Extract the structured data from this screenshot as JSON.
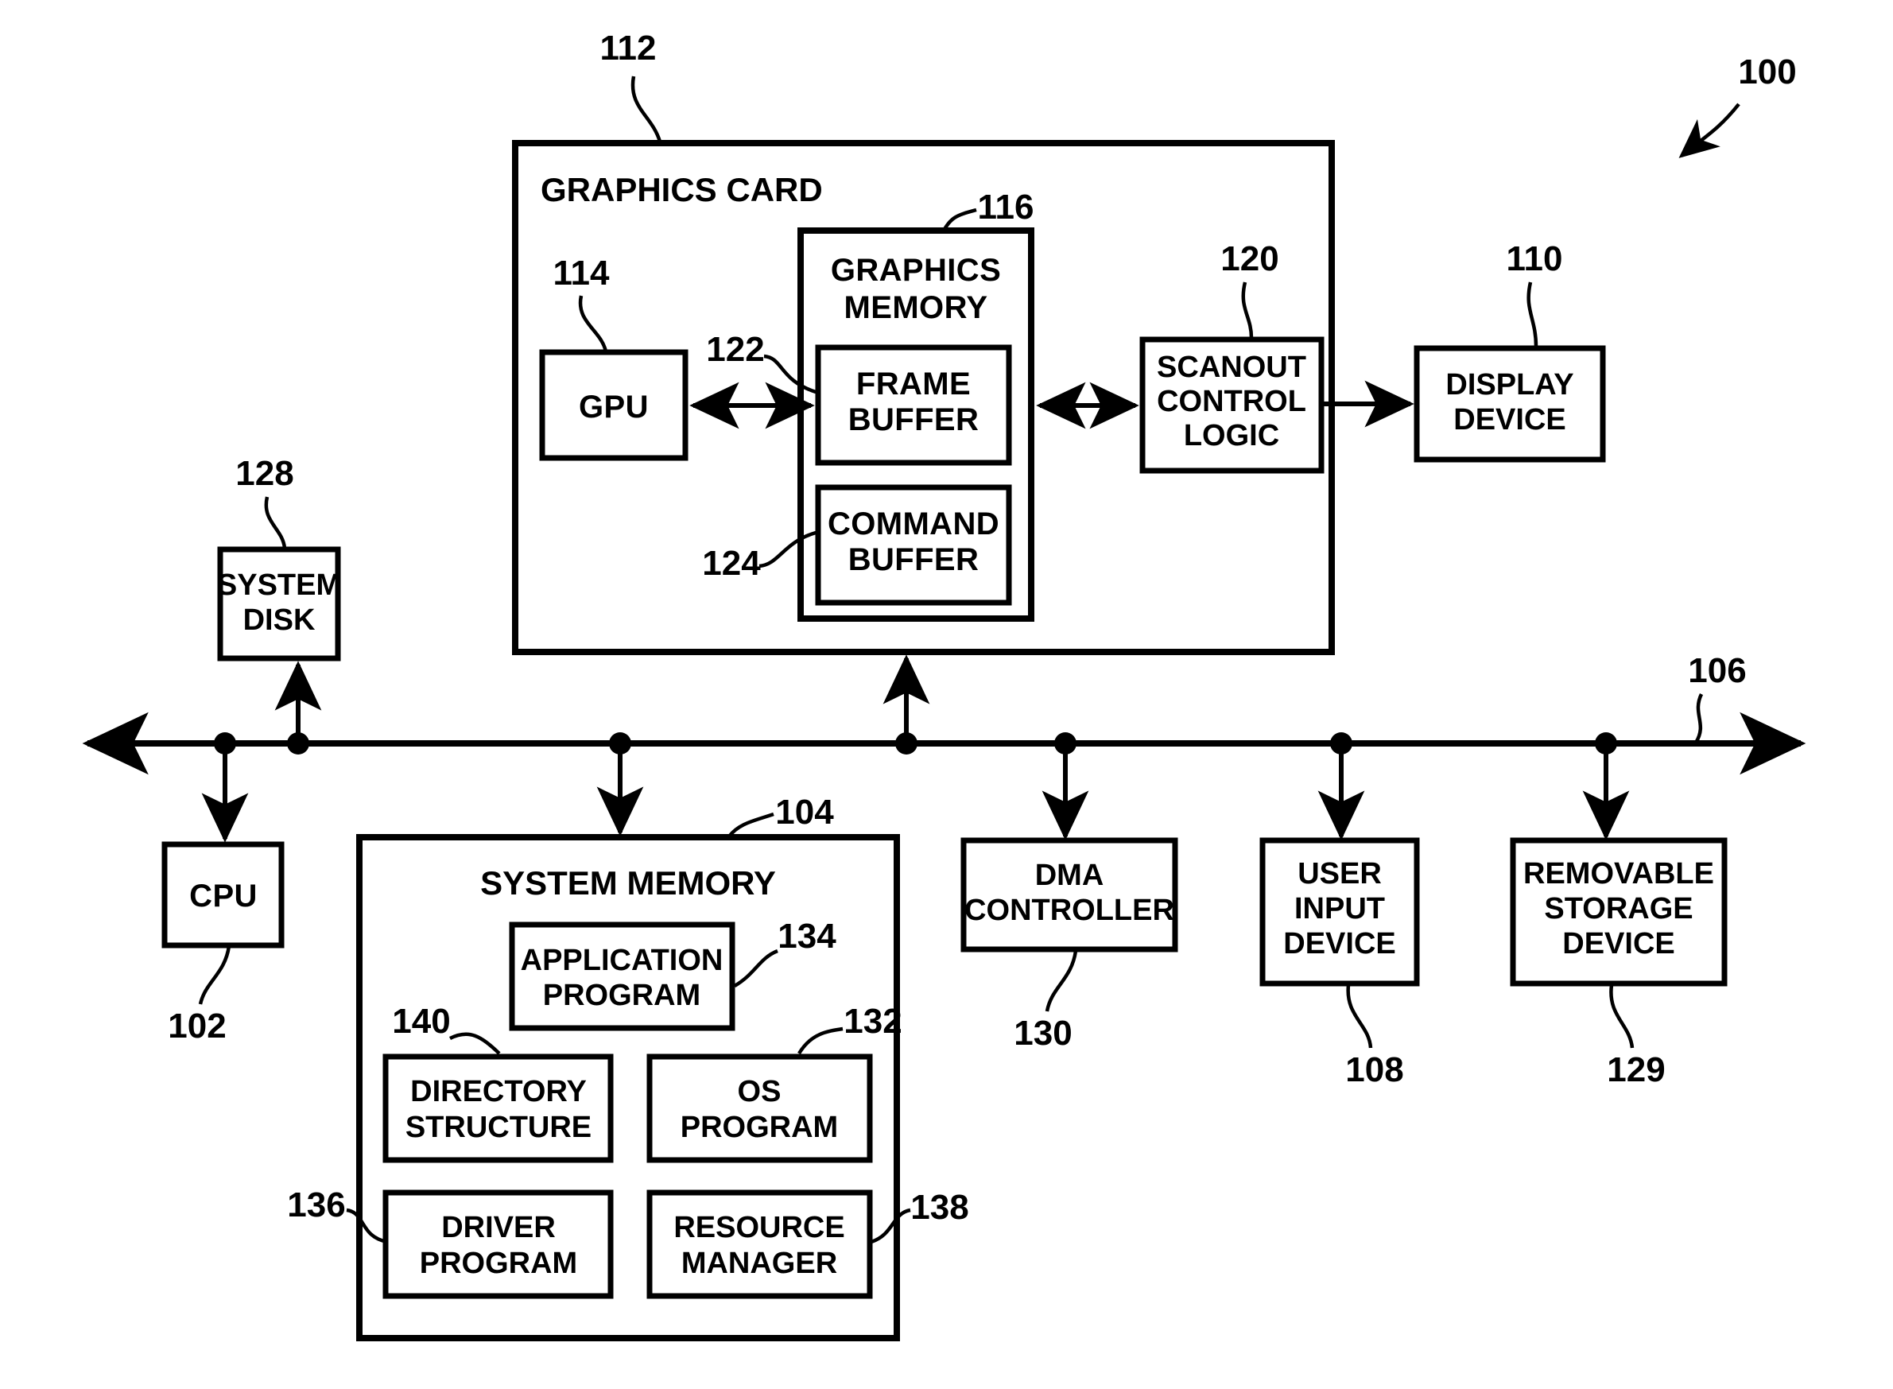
{
  "figure": {
    "reference_numeral": "100",
    "description": "Computer system block diagram"
  },
  "containers": {
    "graphics_card": {
      "title": "GRAPHICS CARD",
      "ref": "112"
    },
    "graphics_memory": {
      "title": "GRAPHICS",
      "title_line2": "MEMORY",
      "ref": "116"
    },
    "system_memory": {
      "title": "SYSTEM MEMORY",
      "ref": "104"
    }
  },
  "blocks": {
    "gpu": {
      "line1": "GPU",
      "line2": "",
      "ref": "114"
    },
    "frame_buffer": {
      "line1": "FRAME",
      "line2": "BUFFER",
      "ref": "122"
    },
    "command_buffer": {
      "line1": "COMMAND",
      "line2": "BUFFER",
      "ref": "124"
    },
    "scanout_control_logic": {
      "line1": "SCANOUT",
      "line2": "CONTROL",
      "line3": "LOGIC",
      "ref": "120"
    },
    "display_device": {
      "line1": "DISPLAY",
      "line2": "DEVICE",
      "ref": "110"
    },
    "system_disk": {
      "line1": "SYSTEM",
      "line2": "DISK",
      "ref": "128"
    },
    "cpu": {
      "line1": "CPU",
      "line2": "",
      "ref": "102"
    },
    "application_program": {
      "line1": "APPLICATION",
      "line2": "PROGRAM",
      "ref": "134"
    },
    "directory_structure": {
      "line1": "DIRECTORY",
      "line2": "STRUCTURE",
      "ref": "140"
    },
    "os_program": {
      "line1": "OS",
      "line2": "PROGRAM",
      "ref": "132"
    },
    "driver_program": {
      "line1": "DRIVER",
      "line2": "PROGRAM",
      "ref": "136"
    },
    "resource_manager": {
      "line1": "RESOURCE",
      "line2": "MANAGER",
      "ref": "138"
    },
    "dma_controller": {
      "line1": "DMA",
      "line2": "CONTROLLER",
      "ref": "130"
    },
    "user_input_device": {
      "line1": "USER",
      "line2": "INPUT",
      "line3": "DEVICE",
      "ref": "108"
    },
    "removable_storage_device": {
      "line1": "REMOVABLE",
      "line2": "STORAGE",
      "line3": "DEVICE",
      "ref": "129"
    }
  },
  "bus": {
    "ref": "106",
    "name": "system bus"
  },
  "colors": {
    "stroke": "#000000",
    "fill": "#ffffff"
  }
}
